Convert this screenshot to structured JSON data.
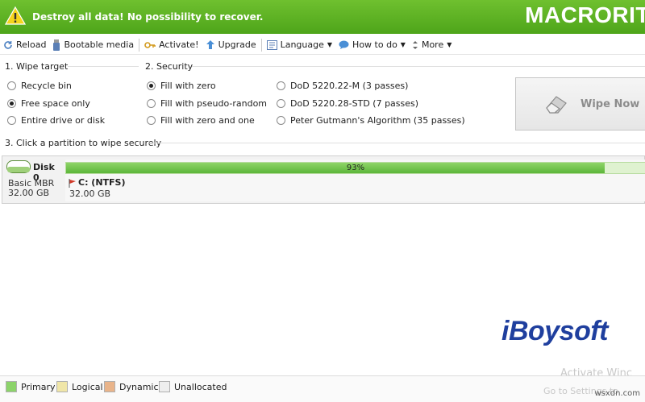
{
  "banner": {
    "warning": "Destroy all data! No possibility to recover.",
    "brand": "MACRORIT"
  },
  "toolbar": {
    "reload": "Reload",
    "bootable": "Bootable media",
    "activate": "Activate!",
    "upgrade": "Upgrade",
    "language": "Language",
    "howto": "How to do",
    "more": "More"
  },
  "wipe_target": {
    "label": "1. Wipe target",
    "options": [
      "Recycle bin",
      "Free space only",
      "Entire drive or disk"
    ],
    "selected": "Free space only"
  },
  "security": {
    "label": "2. Security",
    "options": [
      "Fill with zero",
      "Fill with pseudo-random",
      "Fill with zero and one",
      "DoD 5220.22-M (3 passes)",
      "DoD 5220.28-STD (7 passes)",
      "Peter Gutmann's Algorithm (35 passes)"
    ],
    "selected": "Fill with zero"
  },
  "wipe_button": "Wipe Now",
  "partition_section": "3. Click a partition to wipe securely",
  "disk": {
    "name": "Disk 0",
    "type": "Basic MBR",
    "size": "32.00 GB",
    "partition": {
      "name": "C: (NTFS)",
      "size": "32.00 GB",
      "usage_label": "93%",
      "usage": 0.93
    }
  },
  "legend": {
    "items": [
      {
        "label": "Primary",
        "color": "#8cd36a"
      },
      {
        "label": "Logical",
        "color": "#f0e6a8"
      },
      {
        "label": "Dynamic",
        "color": "#e9b48a"
      },
      {
        "label": "Unallocated",
        "color": "#eeeeee"
      }
    ]
  },
  "watermark": {
    "brand": "iBoysoft",
    "activate1": "Activate Winc",
    "activate2": "Go to Settings to",
    "site": "wsxdn.com"
  },
  "colors": {
    "banner": "#5db224",
    "accent": "#5cb63a"
  }
}
